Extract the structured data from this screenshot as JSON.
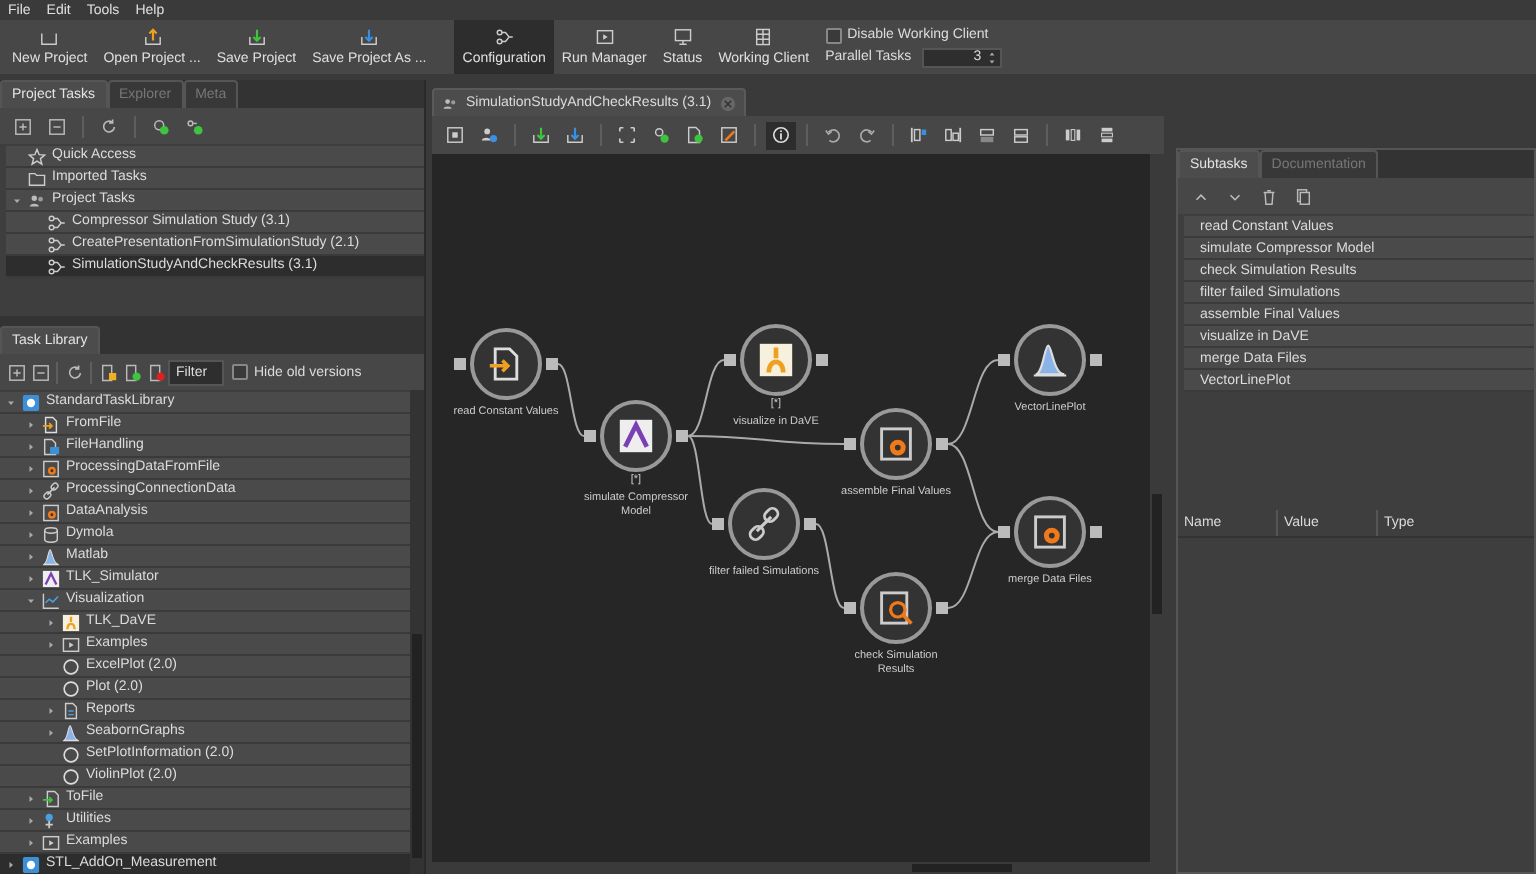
{
  "menu": [
    "File",
    "Edit",
    "Tools",
    "Help"
  ],
  "toolbar": {
    "buttons": [
      {
        "label": "New Project",
        "kind": "new",
        "selected": false
      },
      {
        "label": "Open Project ...",
        "kind": "open",
        "selected": false
      },
      {
        "label": "Save Project",
        "kind": "save",
        "selected": false
      },
      {
        "label": "Save Project As ...",
        "kind": "saveas",
        "selected": false
      },
      {
        "label": "Configuration",
        "kind": "config",
        "selected": true
      },
      {
        "label": "Run Manager",
        "kind": "run",
        "selected": false
      },
      {
        "label": "Status",
        "kind": "status",
        "selected": false
      },
      {
        "label": "Working Client",
        "kind": "client",
        "selected": false
      }
    ],
    "disable_working_client": {
      "label": "Disable Working Client",
      "checked": false
    },
    "parallel_tasks": {
      "label": "Parallel Tasks",
      "value": "3"
    }
  },
  "project_panel": {
    "tabs": [
      {
        "label": "Project Tasks",
        "selected": true
      },
      {
        "label": "Explorer",
        "selected": false
      },
      {
        "label": "Meta",
        "selected": false
      }
    ],
    "tree": [
      {
        "label": "Quick Access",
        "kind": "star",
        "selected": false
      },
      {
        "label": "Imported Tasks",
        "kind": "folder",
        "selected": false
      },
      {
        "label": "Project Tasks",
        "kind": "project",
        "selected": false,
        "expanded": true,
        "children": [
          {
            "label": "Compressor Simulation Study (3.1)",
            "kind": "flow",
            "selected": false
          },
          {
            "label": "CreatePresentationFromSimulationStudy (2.1)",
            "kind": "flow",
            "selected": false
          },
          {
            "label": "SimulationStudyAndCheckResults (3.1)",
            "kind": "flow",
            "selected": true
          }
        ]
      }
    ]
  },
  "task_library": {
    "tab": "Task Library",
    "filter": {
      "placeholder": "Filter"
    },
    "hide_old_versions": {
      "label": "Hide old versions",
      "checked": false
    },
    "tree": [
      {
        "label": "StandardTaskLibrary",
        "kind": "library",
        "selected": false,
        "expanded": true,
        "children": [
          {
            "label": "FromFile",
            "kind": "import",
            "selected": false,
            "expanded": false
          },
          {
            "label": "FileHandling",
            "kind": "filehandling",
            "selected": false,
            "expanded": false
          },
          {
            "label": "ProcessingDataFromFile",
            "kind": "gearfile",
            "selected": false,
            "expanded": false
          },
          {
            "label": "ProcessingConnectionData",
            "kind": "link",
            "selected": false,
            "expanded": false
          },
          {
            "label": "DataAnalysis",
            "kind": "gearfile",
            "selected": false,
            "expanded": false
          },
          {
            "label": "Dymola",
            "kind": "database",
            "selected": false,
            "expanded": false
          },
          {
            "label": "Matlab",
            "kind": "peak",
            "selected": false,
            "expanded": false
          },
          {
            "label": "TLK_Simulator",
            "kind": "simulator",
            "selected": false,
            "expanded": false
          },
          {
            "label": "Visualization",
            "kind": "chart",
            "selected": false,
            "expanded": true,
            "children": [
              {
                "label": "TLK_DaVE",
                "kind": "dave",
                "selected": false,
                "expanded": false
              },
              {
                "label": "Examples",
                "kind": "examples",
                "selected": false,
                "expanded": false
              },
              {
                "label": "ExcelPlot (2.0)",
                "kind": "task",
                "selected": false
              },
              {
                "label": "Plot (2.0)",
                "kind": "task",
                "selected": false
              },
              {
                "label": "Reports",
                "kind": "report",
                "selected": false,
                "expanded": false
              },
              {
                "label": "SeabornGraphs",
                "kind": "peak",
                "selected": false,
                "expanded": false
              },
              {
                "label": "SetPlotInformation (2.0)",
                "kind": "task",
                "selected": false
              },
              {
                "label": "ViolinPlot (2.0)",
                "kind": "task",
                "selected": false
              }
            ]
          },
          {
            "label": "ToFile",
            "kind": "export",
            "selected": false,
            "expanded": false
          },
          {
            "label": "Utilities",
            "kind": "utilities",
            "selected": false,
            "expanded": false
          },
          {
            "label": "Examples",
            "kind": "examples",
            "selected": false,
            "expanded": false
          }
        ]
      },
      {
        "label": "STL_AddOn_Measurement",
        "kind": "library",
        "selected": true,
        "expanded": false
      }
    ]
  },
  "editor": {
    "tab": {
      "label": "SimulationStudyAndCheckResults (3.1)"
    },
    "info_mode": {
      "on": true
    },
    "nodes": [
      {
        "label": "read Constant Values",
        "kind": "import"
      },
      {
        "label": "simulate Compressor Model",
        "kind": "simulator",
        "marker": "[*]"
      },
      {
        "label": "visualize in DaVE",
        "kind": "dave",
        "marker": "[*]"
      },
      {
        "label": "assemble Final Values",
        "kind": "gearfile"
      },
      {
        "label": "filter failed Simulations",
        "kind": "link"
      },
      {
        "label": "check Simulation Results",
        "kind": "search"
      },
      {
        "label": "VectorLinePlot",
        "kind": "peak"
      },
      {
        "label": "merge Data Files",
        "kind": "gearfile"
      }
    ]
  },
  "subtasks_panel": {
    "tabs": [
      {
        "label": "Subtasks",
        "selected": true
      },
      {
        "label": "Documentation",
        "selected": false
      }
    ],
    "items": [
      "read Constant Values",
      "simulate Compressor Model",
      "check Simulation Results",
      "filter failed Simulations",
      "assemble Final Values",
      "visualize in DaVE",
      "merge Data Files",
      "VectorLinePlot"
    ],
    "columns": [
      "Name",
      "Value",
      "Type"
    ]
  }
}
